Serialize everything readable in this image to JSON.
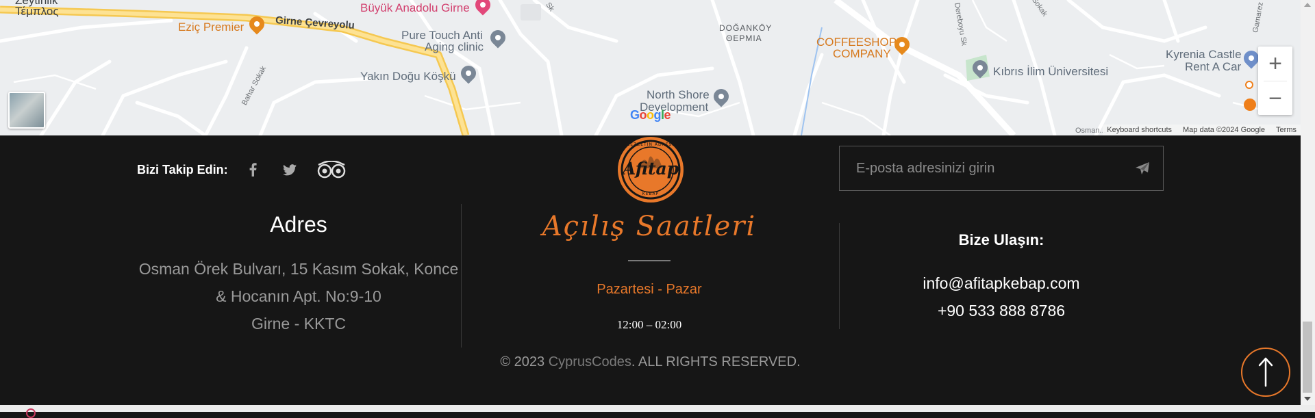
{
  "map": {
    "labels": {
      "greek_top": "Τέμπλος",
      "greek_top_partial": "Ζeytinlik",
      "restaurant": "Eziç Premier",
      "road": "Girne Çevreyolu",
      "buyuk_anadolu": "Büyük Anadolu Girne",
      "pure_touch_line1": "Pure Touch Anti",
      "pure_touch_line2": "Aging clinic",
      "yakin_dogu": "Yakın Doğu Köşkü",
      "doganko_line1": "DOĞANKÖY",
      "doganko_line2": "ΘΕΡΜΙΑ",
      "coffeeshop_line1": "COFFEESHOP",
      "coffeeshop_line2": "COMPANY",
      "kibris_ilim": "Kıbrıs İlim Üniversitesi",
      "kyrenia_castle_line1": "Kyrenia Castle",
      "kyrenia_castle_line2": "Rent A Car",
      "north_shore_line1": "North Shore",
      "north_shore_line2": "Development",
      "street_bahar": "Bahar Sokak",
      "street_dereboyu": "Dereboyu Sk",
      "street_gamarez": "Gamarez",
      "street_osman": "Osman...",
      "street_sokak": "Sokak",
      "street_sk": "Sk"
    },
    "zoom_in": "+",
    "zoom_out": "−",
    "google": [
      "G",
      "o",
      "o",
      "g",
      "l",
      "e"
    ],
    "footer": {
      "shortcuts": "Keyboard shortcuts",
      "map_data": "Map data ©2024 Google",
      "terms": "Terms"
    }
  },
  "footer": {
    "follow_label": "Bizi Takip Edin:",
    "social": [
      "facebook-icon",
      "twitter-icon",
      "tripadvisor-icon"
    ],
    "logo": {
      "top_text": "LEZZETİN ADRESİ",
      "name": "Afitap",
      "bottom_text": "KEBAP"
    },
    "newsletter": {
      "placeholder": "E-posta adresinizi girin"
    },
    "address": {
      "title": "Adres",
      "line1": "Osman Örek Bulvarı, 15 Kasım Sokak, Konce",
      "line2": "& Hocanın Apt. No:9-10",
      "line3": "Girne - KKTC"
    },
    "hours": {
      "title": "Açılış Saatleri",
      "days": "Pazartesi - Pazar",
      "time": "12:00 – 02:00"
    },
    "contact": {
      "title": "Bize Ulaşın:",
      "email": "info@afitapkebap.com",
      "phone": "+90 533 888 8786"
    },
    "copyright": {
      "prefix": "© 2023 ",
      "link": "CyprusCodes",
      "suffix": ". ALL RIGHTS RESERVED."
    },
    "scroll_top_icon": "arrow-up-icon"
  },
  "colors": {
    "accent": "#e8782a",
    "footer_bg": "#161616",
    "map_bg": "#eceef0"
  }
}
